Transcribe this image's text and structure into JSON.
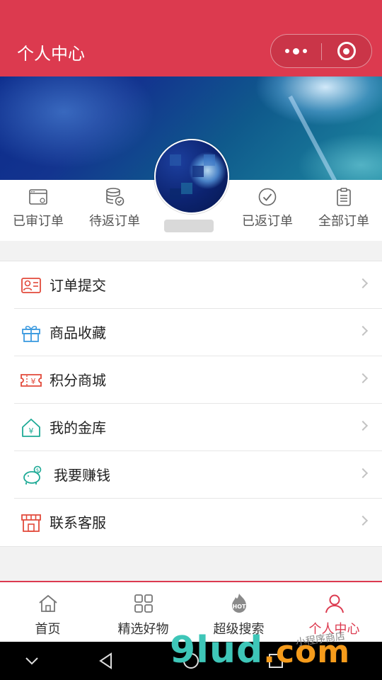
{
  "header": {
    "title": "个人中心"
  },
  "colors": {
    "brand": "#dc3a4f",
    "tab_active": "#dc3a4f",
    "text": "#333333"
  },
  "orders": [
    {
      "label": "已审订单",
      "icon": "browser-window-icon"
    },
    {
      "label": "待返订单",
      "icon": "coin-stack-check-icon"
    },
    {
      "label": "已返订单",
      "icon": "check-circle-icon"
    },
    {
      "label": "全部订单",
      "icon": "clipboard-icon"
    }
  ],
  "menu": [
    {
      "label": "订单提交",
      "icon": "id-card-user-icon"
    },
    {
      "label": "商品收藏",
      "icon": "gift-icon"
    },
    {
      "label": "积分商城",
      "icon": "coupon-ticket-icon"
    },
    {
      "label": "我的金库",
      "icon": "house-yuan-icon"
    },
    {
      "label": "我要赚钱",
      "icon": "piggy-bank-icon"
    },
    {
      "label": "联系客服",
      "icon": "store-front-icon"
    }
  ],
  "tabs": [
    {
      "label": "首页",
      "icon": "home-icon"
    },
    {
      "label": "精选好物",
      "icon": "grid-icon"
    },
    {
      "label": "超级搜索",
      "icon": "hot-flame-icon"
    },
    {
      "label": "个人中心",
      "icon": "user-icon",
      "active": true
    }
  ],
  "watermark": {
    "main": "9lud",
    "domain": ".com",
    "small": "小程序商店"
  }
}
